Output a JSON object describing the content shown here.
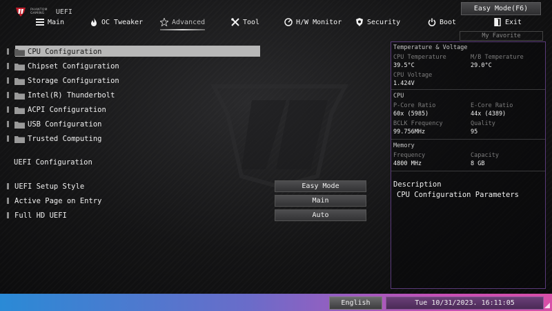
{
  "brand": {
    "line1": "PHANTOM",
    "line2": "GAMING",
    "uefi": "UEFI"
  },
  "top_buttons": {
    "easy_mode": "Easy Mode(F6)",
    "my_favorite": "My Favorite"
  },
  "tabs": [
    {
      "label": "Main",
      "icon": "grid-icon"
    },
    {
      "label": "OC Tweaker",
      "icon": "flame-icon"
    },
    {
      "label": "Advanced",
      "icon": "star-icon",
      "active": true
    },
    {
      "label": "Tool",
      "icon": "tools-icon"
    },
    {
      "label": "H/W Monitor",
      "icon": "monitor-icon"
    },
    {
      "label": "Security",
      "icon": "shield-icon"
    },
    {
      "label": "Boot",
      "icon": "power-icon"
    },
    {
      "label": "Exit",
      "icon": "exit-icon"
    }
  ],
  "menu": [
    {
      "label": "CPU Configuration",
      "selected": true
    },
    {
      "label": "Chipset Configuration"
    },
    {
      "label": "Storage Configuration"
    },
    {
      "label": "Intel(R) Thunderbolt"
    },
    {
      "label": "ACPI Configuration"
    },
    {
      "label": "USB Configuration"
    },
    {
      "label": "Trusted Computing"
    }
  ],
  "section_title": "UEFI Configuration",
  "settings": [
    {
      "label": "UEFI Setup Style",
      "value": "Easy Mode"
    },
    {
      "label": "Active Page on Entry",
      "value": "Main"
    },
    {
      "label": "Full HD UEFI",
      "value": "Auto"
    }
  ],
  "info": {
    "temp_title": "Temperature & Voltage",
    "cpu_temp_label": "CPU Temperature",
    "cpu_temp": "39.5°C",
    "mb_temp_label": "M/B Temperature",
    "mb_temp": "29.0°C",
    "cpu_volt_label": "CPU Voltage",
    "cpu_volt": "1.424V",
    "cpu_title": "CPU",
    "pcore_label": "P-Core Ratio",
    "pcore": "60x (5985)",
    "ecore_label": "E-Core Ratio",
    "ecore": "44x (4389)",
    "bclk_label": "BCLK Frequency",
    "bclk": "99.756MHz",
    "quality_label": "Quality",
    "quality": "95",
    "mem_title": "Memory",
    "freq_label": "Frequency",
    "freq": "4800 MHz",
    "cap_label": "Capacity",
    "cap": "8 GB"
  },
  "description": {
    "title": "Description",
    "text": "CPU Configuration Parameters"
  },
  "bottom": {
    "language": "English",
    "datetime": "Tue 10/31/2023. 16:11:05"
  }
}
